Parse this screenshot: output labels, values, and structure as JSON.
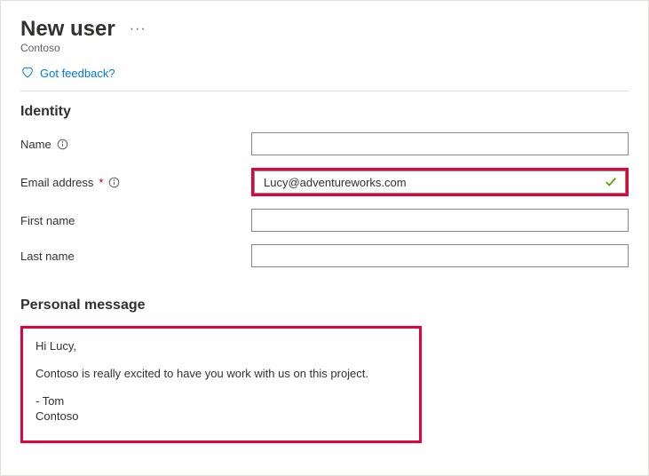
{
  "header": {
    "title": "New user",
    "subtitle": "Contoso",
    "feedback_label": "Got feedback?"
  },
  "identity": {
    "heading": "Identity",
    "name_label": "Name",
    "email_label": "Email address",
    "first_name_label": "First name",
    "last_name_label": "Last name",
    "name_value": "",
    "email_value": "Lucy@adventureworks.com",
    "first_name_value": "",
    "last_name_value": ""
  },
  "personal": {
    "heading": "Personal message",
    "line1": "Hi Lucy,",
    "line2": "Contoso is really excited to have you work with us on this project.",
    "line3": "- Tom",
    "line4": "Contoso"
  }
}
